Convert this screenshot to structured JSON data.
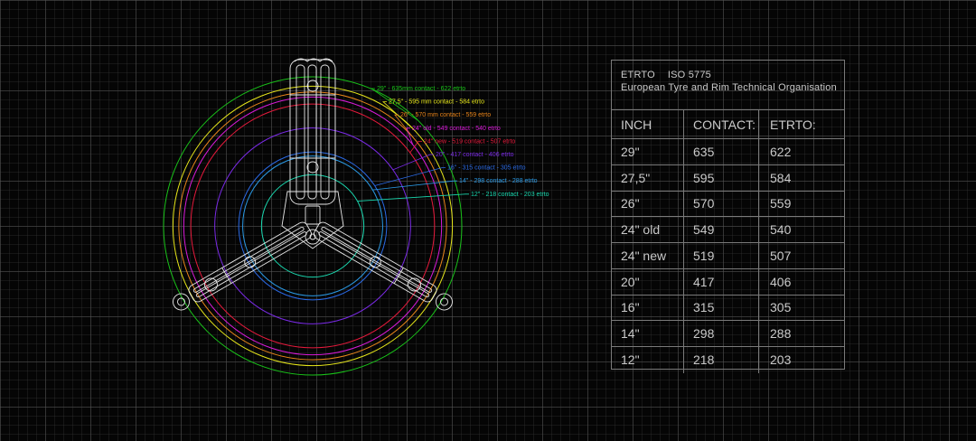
{
  "table": {
    "title": "ETRTO",
    "standard": "ISO 5775",
    "subtitle": "European Tyre and Rim Technical Organisation",
    "headers": [
      "INCH",
      "CONTACT:",
      "ETRTO:"
    ],
    "rows": [
      [
        "29\"",
        "635",
        "622"
      ],
      [
        "27,5\"",
        "595",
        "584"
      ],
      [
        "26\"",
        "570",
        "559"
      ],
      [
        "24\" old",
        "549",
        "540"
      ],
      [
        "24\" new",
        "519",
        "507"
      ],
      [
        "20\"",
        "417",
        "406"
      ],
      [
        "16\"",
        "315",
        "305"
      ],
      [
        "14\"",
        "298",
        "288"
      ],
      [
        "12\"",
        "218",
        "203"
      ]
    ]
  },
  "wheels": [
    {
      "label": "29\" - 635mm contact - 622 etrto",
      "contact_mm": 635,
      "color": "#19c219"
    },
    {
      "label": "27,5\" - 595 mm contact - 584 etrto",
      "contact_mm": 595,
      "color": "#e6e61a"
    },
    {
      "label": "26\" - 570 mm contact - 559 etrto",
      "contact_mm": 570,
      "color": "#e8841a"
    },
    {
      "label": "24\" old - 549 contact - 540 etrto",
      "contact_mm": 549,
      "color": "#d91ad9"
    },
    {
      "label": "24\" new - 519 contact - 507 etrto",
      "contact_mm": 519,
      "color": "#e61a3c"
    },
    {
      "label": "20\" - 417 contact - 406 etrto",
      "contact_mm": 417,
      "color": "#7a2ae6"
    },
    {
      "label": "16\" - 315 contact - 305 etrto",
      "contact_mm": 315,
      "color": "#2a6ae6"
    },
    {
      "label": "14\" - 298 contact - 288 etrto",
      "contact_mm": 298,
      "color": "#2a9ae6"
    },
    {
      "label": "12\" - 218 contact - 203 etrto",
      "contact_mm": 218,
      "color": "#1ad9b0"
    }
  ],
  "colors": {
    "frame": "#e8e8e8",
    "table_text": "#c9c9c9",
    "table_border": "#7a7a7a"
  }
}
